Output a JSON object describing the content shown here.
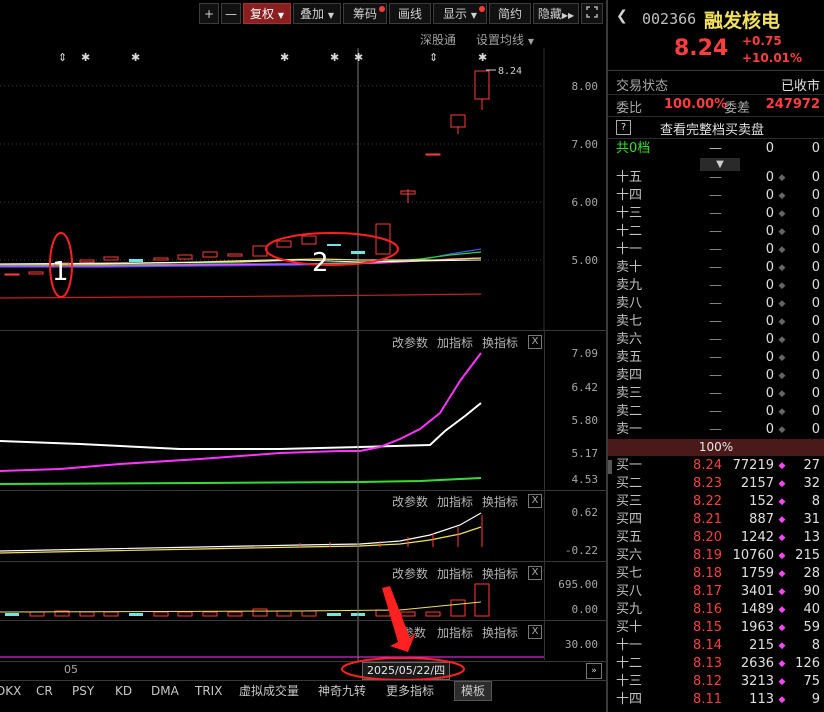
{
  "toolbar": {
    "plus": "+",
    "minus": "—",
    "adjust": "复权",
    "overlay": "叠加",
    "chips": "筹码",
    "draw": "画线",
    "display": "显示",
    "simple": "简约",
    "hide": "隐藏"
  },
  "chart_header": {
    "exchange": "深股通",
    "ma_setting": "设置均线"
  },
  "main_chart": {
    "price_axis": [
      "8.00",
      "7.00",
      "6.00",
      "5.00"
    ],
    "last_price_label": "8.24",
    "annotation_1": "1",
    "annotation_2": "2"
  },
  "indicator_panels": [
    {
      "modify": "改参数",
      "add": "加指标",
      "switch": "换指标",
      "close": "X",
      "axis": [
        "7.09",
        "6.42",
        "5.80",
        "5.17",
        "4.53"
      ]
    },
    {
      "modify": "改参数",
      "add": "加指标",
      "switch": "换指标",
      "close": "X",
      "axis": [
        "0.62",
        "-0.22"
      ]
    },
    {
      "modify": "改参数",
      "add": "加指标",
      "switch": "换指标",
      "close": "X",
      "axis": [
        "695.00",
        "0.00"
      ]
    },
    {
      "modify": "参数",
      "add": "加指标",
      "switch": "换指标",
      "close": "X",
      "axis": [
        "30.00"
      ]
    }
  ],
  "time_axis": {
    "month_label": "05",
    "cursor_date": "2025/05/22/四"
  },
  "bottom_tabs": [
    "DKX",
    "CR",
    "PSY",
    "KD",
    "DMA",
    "TRIX",
    "虚拟成交量",
    "神奇九转",
    "更多指标",
    "模板"
  ],
  "stock": {
    "code": "002366",
    "name": "融发核电",
    "price": "8.24",
    "change": "+0.75",
    "change_pct": "+10.01%"
  },
  "status": {
    "label": "交易状态",
    "value": "已收市",
    "ratio_label": "委比",
    "ratio_value": "100.00%",
    "diff_label": "委差",
    "diff_value": "247972",
    "help_icon": "?",
    "full_book": "查看完整档买卖盘",
    "total_label": "共0档",
    "total_dash": "—",
    "total_v1": "0",
    "total_v2": "0"
  },
  "sell_rows": [
    {
      "label": "十五",
      "price": "—",
      "vol": "0",
      "cnt": "0"
    },
    {
      "label": "十四",
      "price": "—",
      "vol": "0",
      "cnt": "0"
    },
    {
      "label": "十三",
      "price": "—",
      "vol": "0",
      "cnt": "0"
    },
    {
      "label": "十二",
      "price": "—",
      "vol": "0",
      "cnt": "0"
    },
    {
      "label": "十一",
      "price": "—",
      "vol": "0",
      "cnt": "0"
    },
    {
      "label": "卖十",
      "price": "—",
      "vol": "0",
      "cnt": "0"
    },
    {
      "label": "卖九",
      "price": "—",
      "vol": "0",
      "cnt": "0"
    },
    {
      "label": "卖八",
      "price": "—",
      "vol": "0",
      "cnt": "0"
    },
    {
      "label": "卖七",
      "price": "—",
      "vol": "0",
      "cnt": "0"
    },
    {
      "label": "卖六",
      "price": "—",
      "vol": "0",
      "cnt": "0"
    },
    {
      "label": "卖五",
      "price": "—",
      "vol": "0",
      "cnt": "0"
    },
    {
      "label": "卖四",
      "price": "—",
      "vol": "0",
      "cnt": "0"
    },
    {
      "label": "卖三",
      "price": "—",
      "vol": "0",
      "cnt": "0"
    },
    {
      "label": "卖二",
      "price": "—",
      "vol": "0",
      "cnt": "0"
    },
    {
      "label": "卖一",
      "price": "—",
      "vol": "0",
      "cnt": "0"
    }
  ],
  "mid_bar": "100%",
  "buy_rows": [
    {
      "label": "买一",
      "price": "8.24",
      "vol": "77219",
      "cnt": "27"
    },
    {
      "label": "买二",
      "price": "8.23",
      "vol": "2157",
      "cnt": "32"
    },
    {
      "label": "买三",
      "price": "8.22",
      "vol": "152",
      "cnt": "8"
    },
    {
      "label": "买四",
      "price": "8.21",
      "vol": "887",
      "cnt": "31"
    },
    {
      "label": "买五",
      "price": "8.20",
      "vol": "1242",
      "cnt": "13"
    },
    {
      "label": "买六",
      "price": "8.19",
      "vol": "10760",
      "cnt": "215"
    },
    {
      "label": "买七",
      "price": "8.18",
      "vol": "1759",
      "cnt": "28"
    },
    {
      "label": "买八",
      "price": "8.17",
      "vol": "3401",
      "cnt": "90"
    },
    {
      "label": "买九",
      "price": "8.16",
      "vol": "1489",
      "cnt": "40"
    },
    {
      "label": "买十",
      "price": "8.15",
      "vol": "1963",
      "cnt": "59"
    },
    {
      "label": "十一",
      "price": "8.14",
      "vol": "215",
      "cnt": "8"
    },
    {
      "label": "十二",
      "price": "8.13",
      "vol": "2636",
      "cnt": "126"
    },
    {
      "label": "十三",
      "price": "8.12",
      "vol": "3213",
      "cnt": "75"
    },
    {
      "label": "十四",
      "price": "8.11",
      "vol": "113",
      "cnt": "9"
    }
  ],
  "colors": {
    "up": "#ff3d3d",
    "flat": "#6ee6e6",
    "ma5": "#ffffff",
    "ma10": "#f3e05c",
    "ma20": "#ff44ff",
    "ma60": "#33cc33",
    "ma120": "#3355ff",
    "long_ma": "#c82020",
    "annotation": "#ff2020"
  }
}
